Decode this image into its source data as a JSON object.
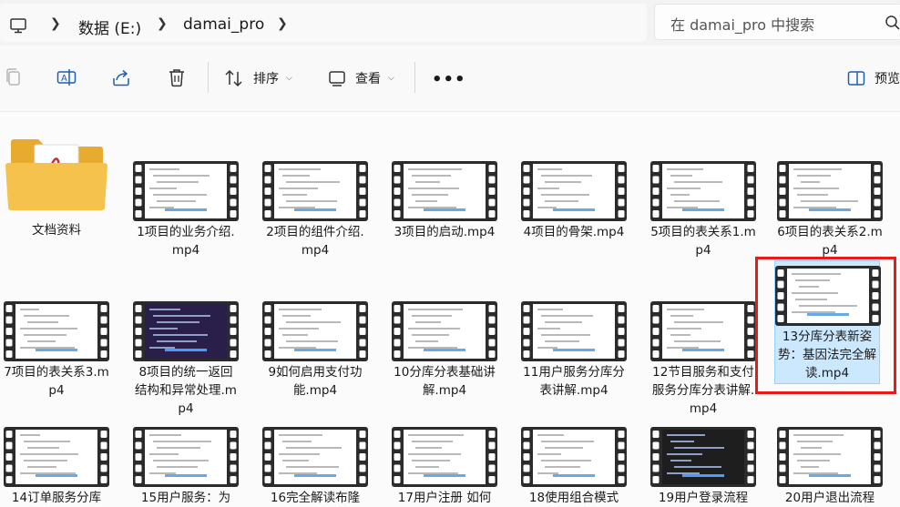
{
  "address": {
    "crumbs": [
      "数据 (E:)",
      "damai_pro"
    ],
    "search_placeholder": "在 damai_pro 中搜索"
  },
  "toolbar": {
    "sort_label": "排序",
    "view_label": "查看",
    "preview_label": "预览"
  },
  "colors": {
    "selection_bg": "#cce8ff",
    "highlight_border": "#e81b1b",
    "folder": "#f4c24d"
  },
  "files": [
    {
      "name": "文档资料",
      "kind": "folder"
    },
    {
      "name": "1项目的业务介绍.mp4",
      "kind": "video"
    },
    {
      "name": "2项目的组件介绍.mp4",
      "kind": "video"
    },
    {
      "name": "3项目的启动.mp4",
      "kind": "video"
    },
    {
      "name": "4项目的骨架.mp4",
      "kind": "video"
    },
    {
      "name": "5项目的表关系1.mp4",
      "kind": "video"
    },
    {
      "name": "6项目的表关系2.mp4",
      "kind": "video"
    },
    {
      "name": "7项目的表关系3.mp4",
      "kind": "video"
    },
    {
      "name": "8项目的统一返回结构和异常处理.mp4",
      "kind": "video"
    },
    {
      "name": "9如何启用支付功能.mp4",
      "kind": "video"
    },
    {
      "name": "10分库分表基础讲解.mp4",
      "kind": "video"
    },
    {
      "name": "11用户服务分库分表讲解.mp4",
      "kind": "video"
    },
    {
      "name": "12节目服务和支付服务分库分表讲解.mp4",
      "kind": "video"
    },
    {
      "name": "13分库分表新姿势：基因法完全解读.mp4",
      "kind": "video",
      "selected": true
    },
    {
      "name": "14订单服务分库",
      "kind": "video"
    },
    {
      "name": "15用户服务：为",
      "kind": "video"
    },
    {
      "name": "16完全解读布隆",
      "kind": "video"
    },
    {
      "name": "17用户注册 如何",
      "kind": "video"
    },
    {
      "name": "18使用组合模式",
      "kind": "video"
    },
    {
      "name": "19用户登录流程",
      "kind": "video"
    },
    {
      "name": "20用户退出流程",
      "kind": "video"
    }
  ]
}
